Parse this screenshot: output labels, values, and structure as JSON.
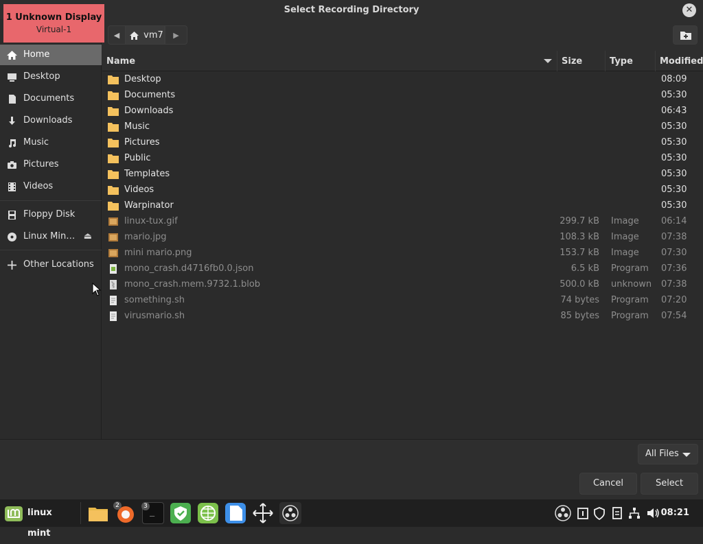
{
  "dialog": {
    "title": "Select Recording Directory"
  },
  "display_overlay": {
    "line1": "1  Unknown Display",
    "line2": "Virtual-1"
  },
  "pathbar": {
    "current": "vm7"
  },
  "sidebar": {
    "items": [
      {
        "label": "Home",
        "icon": "home-icon",
        "active": true
      },
      {
        "label": "Desktop",
        "icon": "desktop-icon"
      },
      {
        "label": "Documents",
        "icon": "documents-icon"
      },
      {
        "label": "Downloads",
        "icon": "downloads-icon"
      },
      {
        "label": "Music",
        "icon": "music-icon"
      },
      {
        "label": "Pictures",
        "icon": "pictures-icon"
      },
      {
        "label": "Videos",
        "icon": "videos-icon"
      },
      {
        "label": "Floppy Disk",
        "icon": "floppy-icon"
      },
      {
        "label": "Linux Min…",
        "icon": "disc-icon",
        "eject": true
      },
      {
        "label": "Other Locations",
        "icon": "plus-icon"
      }
    ]
  },
  "columns": {
    "name": "Name",
    "size": "Size",
    "type": "Type",
    "modified": "Modified"
  },
  "files": [
    {
      "name": "Desktop",
      "size": "",
      "type": "",
      "modified": "08:09",
      "kind": "folder"
    },
    {
      "name": "Documents",
      "size": "",
      "type": "",
      "modified": "05:30",
      "kind": "folder"
    },
    {
      "name": "Downloads",
      "size": "",
      "type": "",
      "modified": "06:43",
      "kind": "folder"
    },
    {
      "name": "Music",
      "size": "",
      "type": "",
      "modified": "05:30",
      "kind": "folder"
    },
    {
      "name": "Pictures",
      "size": "",
      "type": "",
      "modified": "05:30",
      "kind": "folder"
    },
    {
      "name": "Public",
      "size": "",
      "type": "",
      "modified": "05:30",
      "kind": "folder"
    },
    {
      "name": "Templates",
      "size": "",
      "type": "",
      "modified": "05:30",
      "kind": "folder"
    },
    {
      "name": "Videos",
      "size": "",
      "type": "",
      "modified": "05:30",
      "kind": "folder"
    },
    {
      "name": "Warpinator",
      "size": "",
      "type": "",
      "modified": "05:30",
      "kind": "folder"
    },
    {
      "name": "linux-tux.gif",
      "size": "299.7 kB",
      "type": "Image",
      "modified": "06:14",
      "kind": "image"
    },
    {
      "name": "mario.jpg",
      "size": "108.3 kB",
      "type": "Image",
      "modified": "07:38",
      "kind": "image"
    },
    {
      "name": "mini mario.png",
      "size": "153.7 kB",
      "type": "Image",
      "modified": "07:30",
      "kind": "image"
    },
    {
      "name": "mono_crash.d4716fb0.0.json",
      "size": "6.5 kB",
      "type": "Program",
      "modified": "07:36",
      "kind": "json"
    },
    {
      "name": "mono_crash.mem.9732.1.blob",
      "size": "500.0 kB",
      "type": "unknown",
      "modified": "07:38",
      "kind": "blob"
    },
    {
      "name": "something.sh",
      "size": "74 bytes",
      "type": "Program",
      "modified": "07:20",
      "kind": "script"
    },
    {
      "name": "virusmario.sh",
      "size": "85 bytes",
      "type": "Program",
      "modified": "07:54",
      "kind": "script"
    }
  ],
  "footer": {
    "filter": "All Files",
    "cancel": "Cancel",
    "select": "Select"
  },
  "taskbar": {
    "menu_label": "linux mint",
    "apps": [
      {
        "name": "files-app",
        "badge": ""
      },
      {
        "name": "firefox-app",
        "badge": "2"
      },
      {
        "name": "terminal-app",
        "badge": "3"
      },
      {
        "name": "update-manager-app",
        "badge": ""
      },
      {
        "name": "network-app",
        "badge": ""
      },
      {
        "name": "document-viewer-app",
        "badge": ""
      },
      {
        "name": "move-tool-app",
        "badge": ""
      },
      {
        "name": "obs-app",
        "badge": ""
      }
    ],
    "clock": "08:21"
  },
  "colors": {
    "folder": "#f4c15d",
    "accent": "#8fbc5a",
    "overlay": "#e8676c"
  }
}
